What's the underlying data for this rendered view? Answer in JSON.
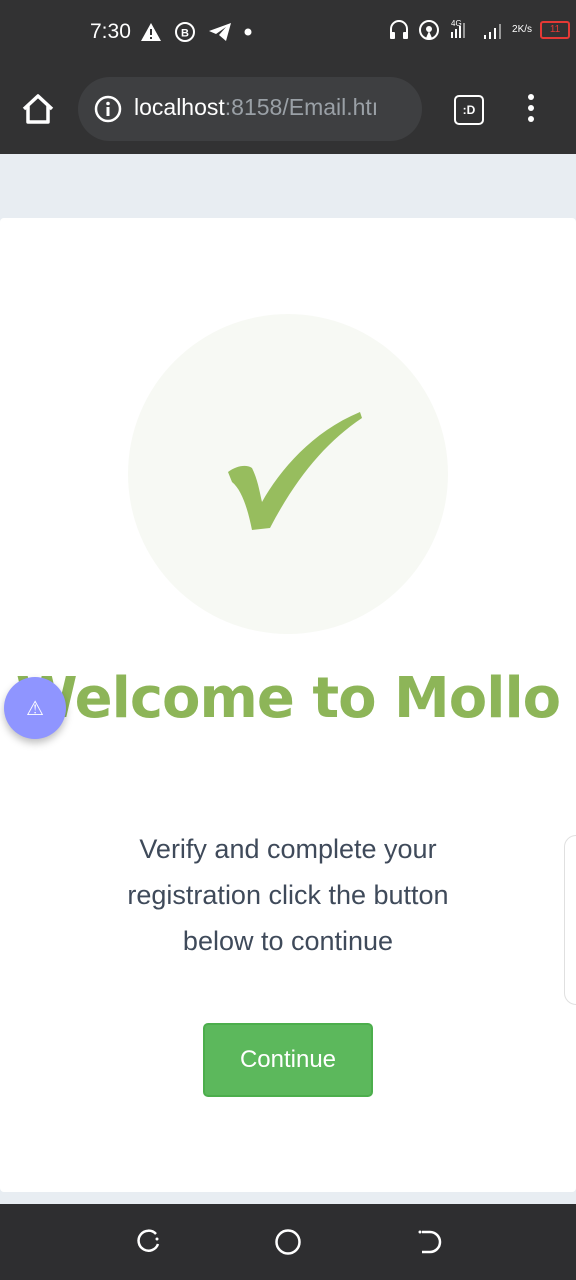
{
  "status_bar": {
    "time": "7:30",
    "left_icons": [
      "warning-icon",
      "b-icon",
      "telegram-icon",
      "dot-icon"
    ],
    "right_icons": [
      "headphones-icon",
      "hotspot-icon",
      "4g-signal-icon",
      "signal-icon"
    ],
    "network_label": "4G",
    "net_speed_value": "2",
    "net_speed_unit": "K/s",
    "battery": "11",
    "battery_color": "#e53935"
  },
  "browser": {
    "url_host": "localhost",
    "url_path": ":8158/Email.htı",
    "tab_switcher_label": ":D"
  },
  "card": {
    "title": "Welcome to Mollo",
    "message": "Verify and complete your registration click the button below to continue",
    "continue_label": "Continue",
    "accent_color": "#8db558",
    "button_color": "#5cb85c"
  },
  "floating": {
    "warning_symbol": "⚠"
  }
}
